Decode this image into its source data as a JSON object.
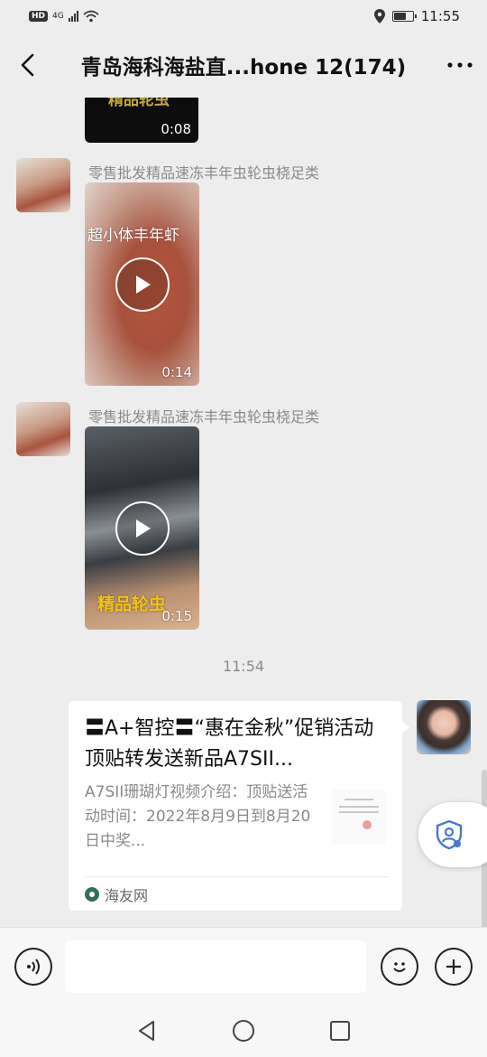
{
  "status_bar": {
    "hd": "HD",
    "network": "4G",
    "time": "11:55",
    "battery_level": 0.7
  },
  "header": {
    "title": "青岛海科海盐直...hone 12(174)",
    "back_icon": "chevron-left-icon",
    "more_icon": "more-dots-icon"
  },
  "messages": [
    {
      "type": "video",
      "overlay_text": "精品轮虫",
      "duration": "0:08"
    },
    {
      "type": "video",
      "sender": "零售批发精品速冻丰年虫轮虫桡足类",
      "overlay_text": "超小体丰年虾",
      "duration": "0:14"
    },
    {
      "type": "video",
      "sender": "零售批发精品速冻丰年虫轮虫桡足类",
      "overlay_text": "精品轮虫",
      "duration": "0:15"
    }
  ],
  "timestamp": "11:54",
  "link_card": {
    "title": "〓A+智控〓“惠在金秋”促销活动顶贴转发送新品A7SII...",
    "description": "A7SII珊瑚灯视频介绍：顶贴送活动时间：2022年8月9日到8月20日中奖...",
    "source": "海友网"
  },
  "input_bar": {
    "placeholder": "",
    "voice_icon": "voice-icon",
    "emoji_icon": "emoji-icon",
    "plus_icon": "plus-icon"
  },
  "nav_bar": {
    "back_icon": "triangle-back-icon",
    "home_icon": "circle-home-icon",
    "recents_icon": "square-recents-icon"
  },
  "colors": {
    "chat_bg": "#ededed",
    "bubble_white": "#ffffff",
    "meta_gray": "#8a8a8a",
    "overlay_yellow": "#f2c21b"
  }
}
